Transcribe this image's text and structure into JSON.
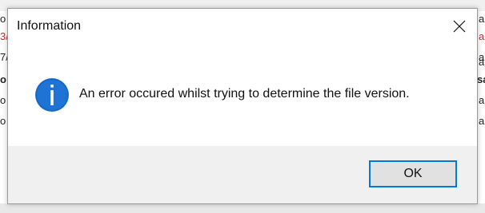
{
  "dialog": {
    "title": "Information",
    "message": "An error occured whilst trying to determine the file version.",
    "ok_label": "OK",
    "icon": "information-icon",
    "close_icon": "close-icon"
  },
  "background": {
    "left_fragments": [
      "o",
      "3/",
      "7/",
      "o",
      "o",
      "o"
    ],
    "right_fragments": [
      "a",
      "a",
      "a",
      "a",
      "sa",
      "a",
      "a"
    ]
  },
  "colors": {
    "accent": "#0078d7",
    "info_icon_fill": "#1e73d4",
    "footer_bg": "#f0f0f0",
    "error_red": "#d9262b"
  }
}
